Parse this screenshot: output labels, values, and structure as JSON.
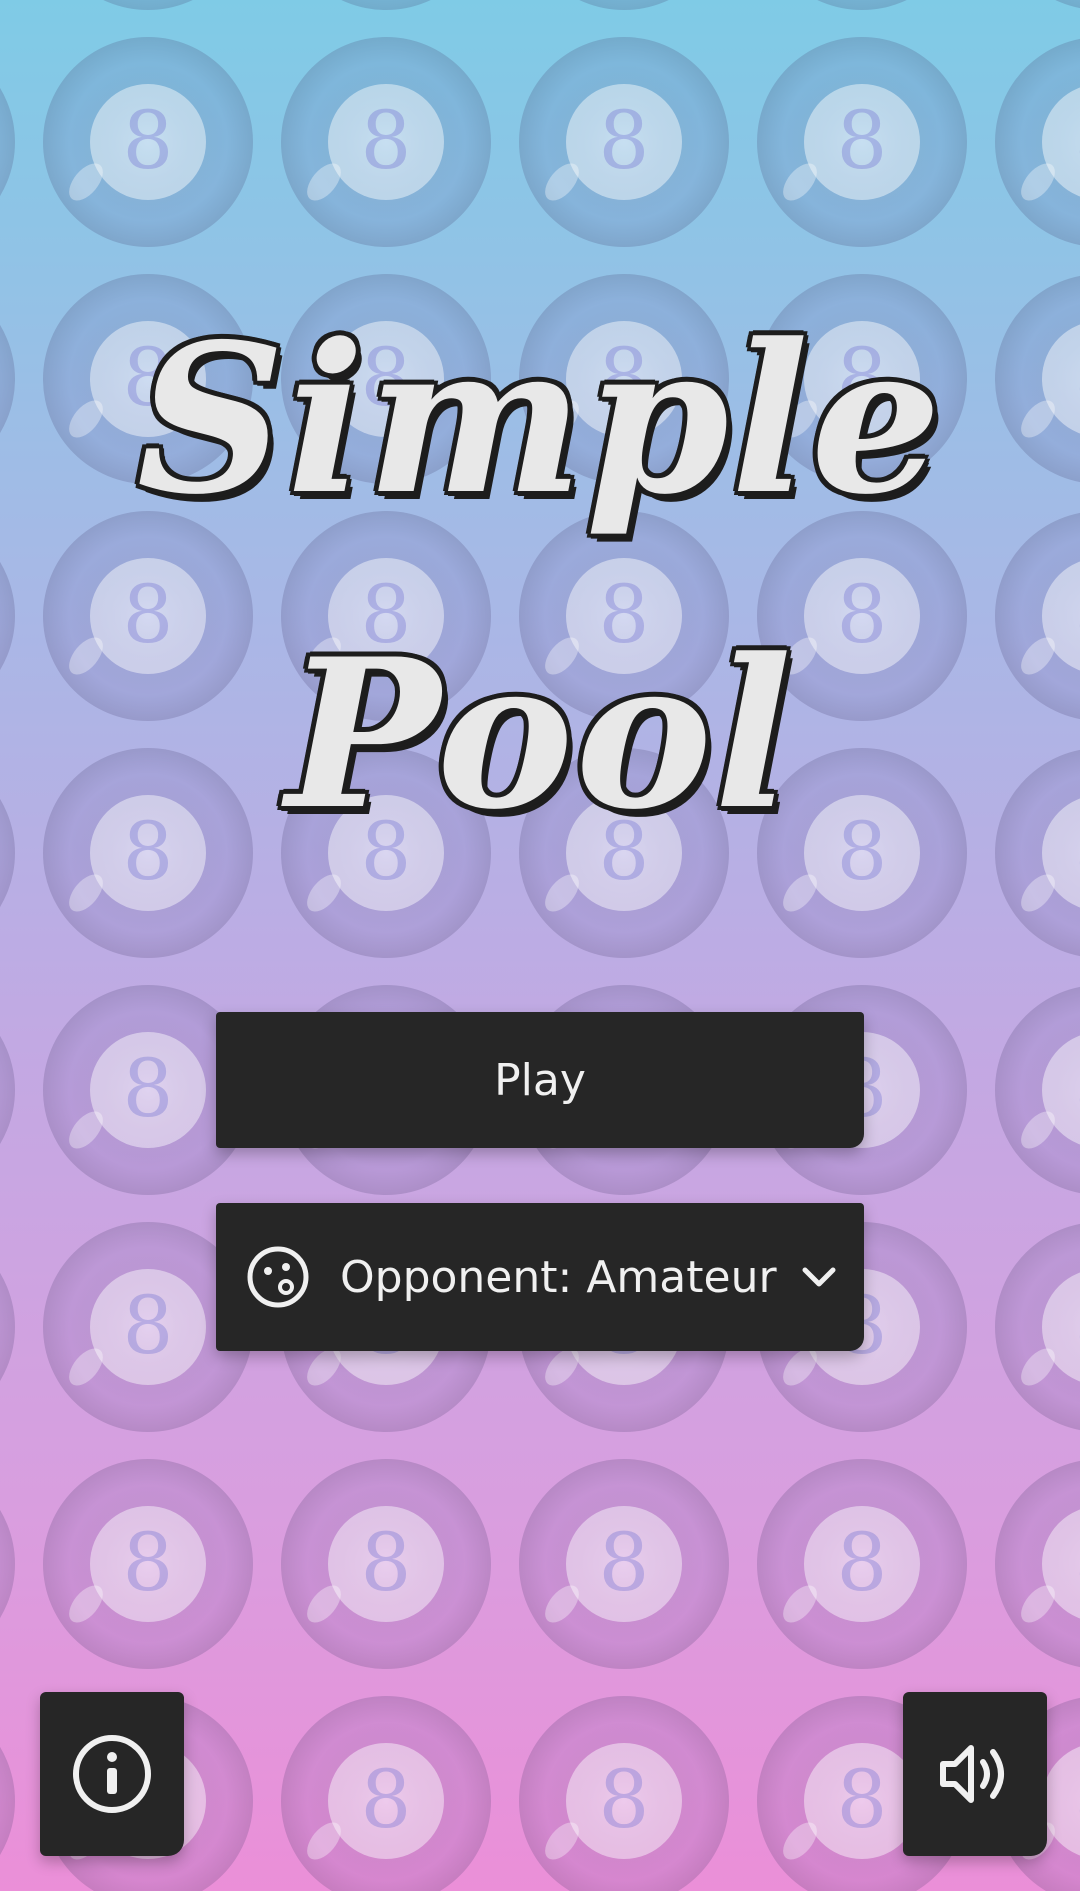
{
  "title": {
    "line1": "Simple",
    "line2": "Pool"
  },
  "background": {
    "ball_number": "8",
    "top_color": "#7fcbe6",
    "bottom_color": "#eb8fd8"
  },
  "menu": {
    "play_label": "Play",
    "opponent_label": "Opponent: Amateur",
    "opponent_icon": "opponent-face-icon",
    "dropdown_icon": "chevron-down-icon"
  },
  "corner_buttons": {
    "info_icon": "info-icon",
    "sound_icon": "volume-icon"
  },
  "colors": {
    "button_bg": "#262626",
    "button_text": "#f0f0f0",
    "title_fill": "#e8e8e8",
    "title_outline": "#1d1d1d"
  }
}
